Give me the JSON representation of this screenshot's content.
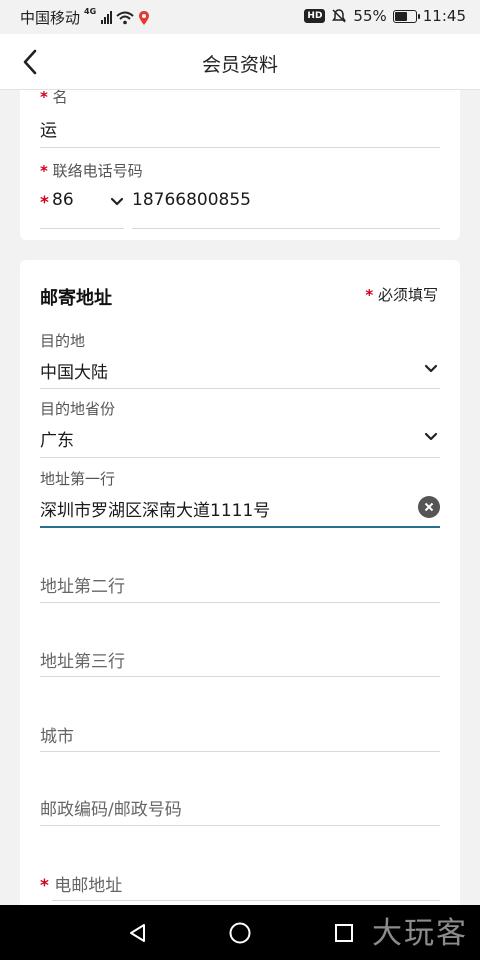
{
  "status_bar": {
    "carrier": "中国移动",
    "network": "4G",
    "hd": "HD",
    "battery": "55%",
    "battery_level": 0.55,
    "time": "11:45"
  },
  "header": {
    "title": "会员资料"
  },
  "profile": {
    "name_label": "名",
    "name_value": "运",
    "phone_label": "联络电话号码",
    "country_code": "86",
    "phone_number": "18766800855"
  },
  "address": {
    "section_title": "邮寄地址",
    "required_note": "必须填写",
    "required_mark": "*",
    "destination_label": "目的地",
    "destination_value": "中国大陆",
    "province_label": "目的地省份",
    "province_value": "广东",
    "line1_label": "地址第一行",
    "line1_value": "深圳市罗湖区深南大道1111号",
    "line2_placeholder": "地址第二行",
    "line3_placeholder": "地址第三行",
    "city_placeholder": "城市",
    "postcode_placeholder": "邮政编码/邮政号码",
    "email_placeholder": "电邮地址"
  },
  "watermark": "大玩客",
  "colors": {
    "required": "#d0021b",
    "focus_underline": "#2a6f8f"
  },
  "icons": [
    "back-arrow-icon",
    "chevron-down-icon",
    "clear-icon",
    "nav-back-icon",
    "nav-home-icon",
    "nav-recent-icon"
  ]
}
